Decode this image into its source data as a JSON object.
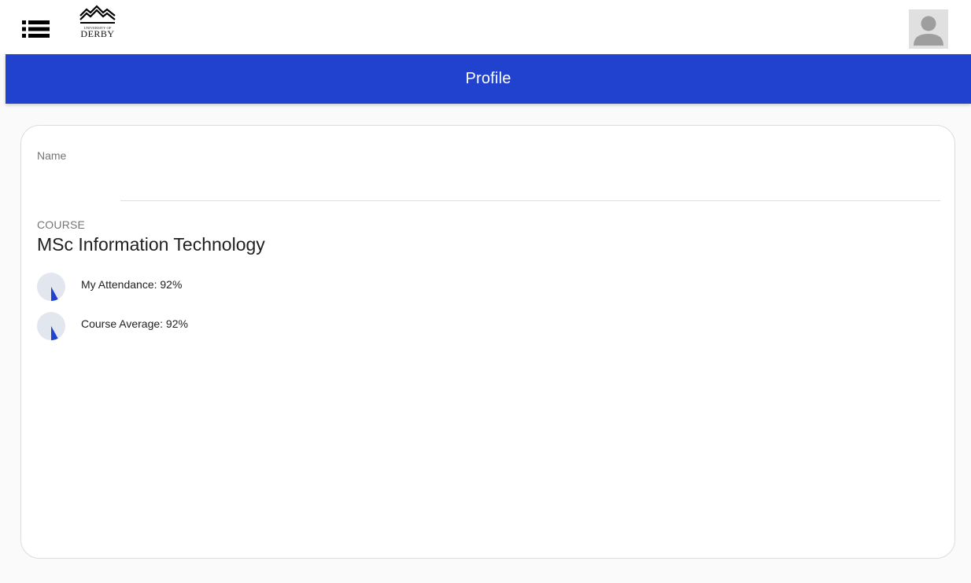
{
  "top_bar": {
    "menu_icon": "menu-list-icon",
    "logo": {
      "line_small": "UNIVERSITY OF",
      "line_big": "DERBY"
    },
    "avatar_icon": "person-icon"
  },
  "title_bar": {
    "title": "Profile",
    "color": "#2142cf"
  },
  "profile": {
    "name_label": "Name",
    "name_value": "",
    "course_label": "COURSE",
    "course_name": "MSc Information Technology",
    "stats": [
      {
        "label": "My Attendance: 92%",
        "percent": 92,
        "icon": "pie-chart-icon"
      },
      {
        "label": "Course Average: 92%",
        "percent": 92,
        "icon": "pie-chart-icon"
      }
    ]
  },
  "colors": {
    "accent": "#2142cf",
    "chart_track": "#e2e6ee"
  }
}
